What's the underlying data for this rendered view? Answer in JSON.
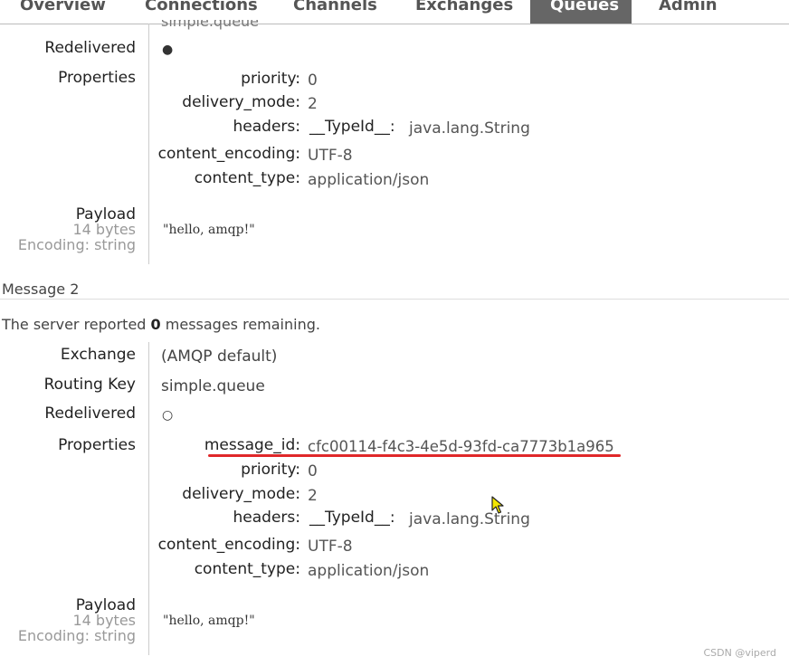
{
  "nav": {
    "tabs": [
      {
        "label": "Overview"
      },
      {
        "label": "Connections"
      },
      {
        "label": "Channels"
      },
      {
        "label": "Exchanges"
      },
      {
        "label": "Queues",
        "active": true
      },
      {
        "label": "Admin"
      }
    ]
  },
  "message1": {
    "partial_top": "simple.queue",
    "redelivered_label": "Redelivered",
    "redelivered_value": "●",
    "properties_label": "Properties",
    "properties": [
      {
        "key": "priority:",
        "value": "0"
      },
      {
        "key": "delivery_mode:",
        "value": "2"
      },
      {
        "key": "headers:",
        "value": "__TypeId__:",
        "value2": "java.lang.String"
      },
      {
        "key": "content_encoding:",
        "value": "UTF-8"
      },
      {
        "key": "content_type:",
        "value": "application/json"
      }
    ],
    "payload_label": "Payload",
    "payload_size": "14 bytes",
    "payload_encoding": "Encoding: string",
    "payload_text": "\"hello, amqp!\""
  },
  "message2": {
    "title": "Message 2",
    "server_text_prefix": "The server reported ",
    "server_count": "0",
    "server_text_suffix": " messages remaining.",
    "exchange_label": "Exchange",
    "exchange_value": "(AMQP default)",
    "routing_key_label": "Routing Key",
    "routing_key_value": "simple.queue",
    "redelivered_label": "Redelivered",
    "redelivered_value": "○",
    "properties_label": "Properties",
    "properties": [
      {
        "key": "message_id:",
        "value": "cfc00114-f4c3-4e5d-93fd-ca7773b1a965"
      },
      {
        "key": "priority:",
        "value": "0"
      },
      {
        "key": "delivery_mode:",
        "value": "2"
      },
      {
        "key": "headers:",
        "value": "__TypeId__:",
        "value2": "java.lang.String"
      },
      {
        "key": "content_encoding:",
        "value": "UTF-8"
      },
      {
        "key": "content_type:",
        "value": "application/json"
      }
    ],
    "payload_label": "Payload",
    "payload_size": "14 bytes",
    "payload_encoding": "Encoding: string",
    "payload_text": "\"hello, amqp!\""
  },
  "watermark": "CSDN @viperd",
  "colors": {
    "active_tab_bg": "#666666",
    "highlight_underline": "#e0282a"
  }
}
